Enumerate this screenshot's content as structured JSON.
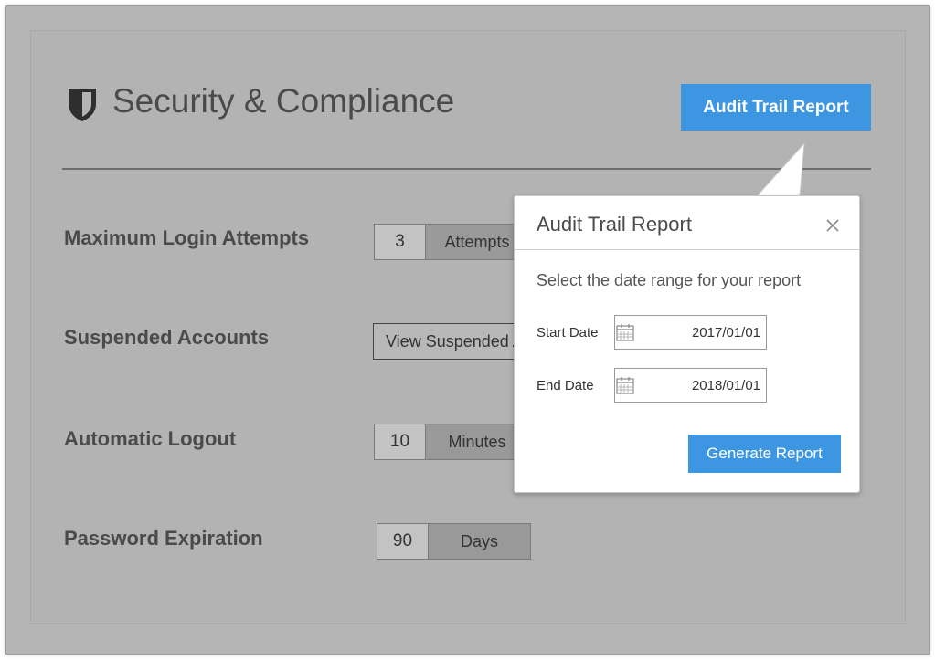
{
  "header": {
    "title": "Security & Compliance",
    "shield_icon": "shield-icon",
    "audit_button_label": "Audit Trail Report"
  },
  "settings": {
    "login_attempts": {
      "label": "Maximum Login Attempts",
      "value": "3",
      "unit": "Attempts"
    },
    "suspended": {
      "label": "Suspended Accounts",
      "button_label": "View Suspended Accounts"
    },
    "auto_logout": {
      "label": "Automatic Logout",
      "value": "10",
      "unit": "Minutes"
    },
    "password_expiration": {
      "label": "Password Expiration",
      "value": "90",
      "unit": "Days"
    }
  },
  "popover": {
    "title": "Audit Trail Report",
    "close_icon": "close-icon",
    "description": "Select the date range for your report",
    "start_label": "Start Date",
    "start_value": "2017/01/01",
    "end_label": "End Date",
    "end_value": "2018/01/01",
    "calendar_icon": "calendar-icon",
    "generate_label": "Generate Report"
  },
  "colors": {
    "accent": "#3d96e2",
    "overlay": "#b3b3b3",
    "text": "#4a4a4a"
  }
}
